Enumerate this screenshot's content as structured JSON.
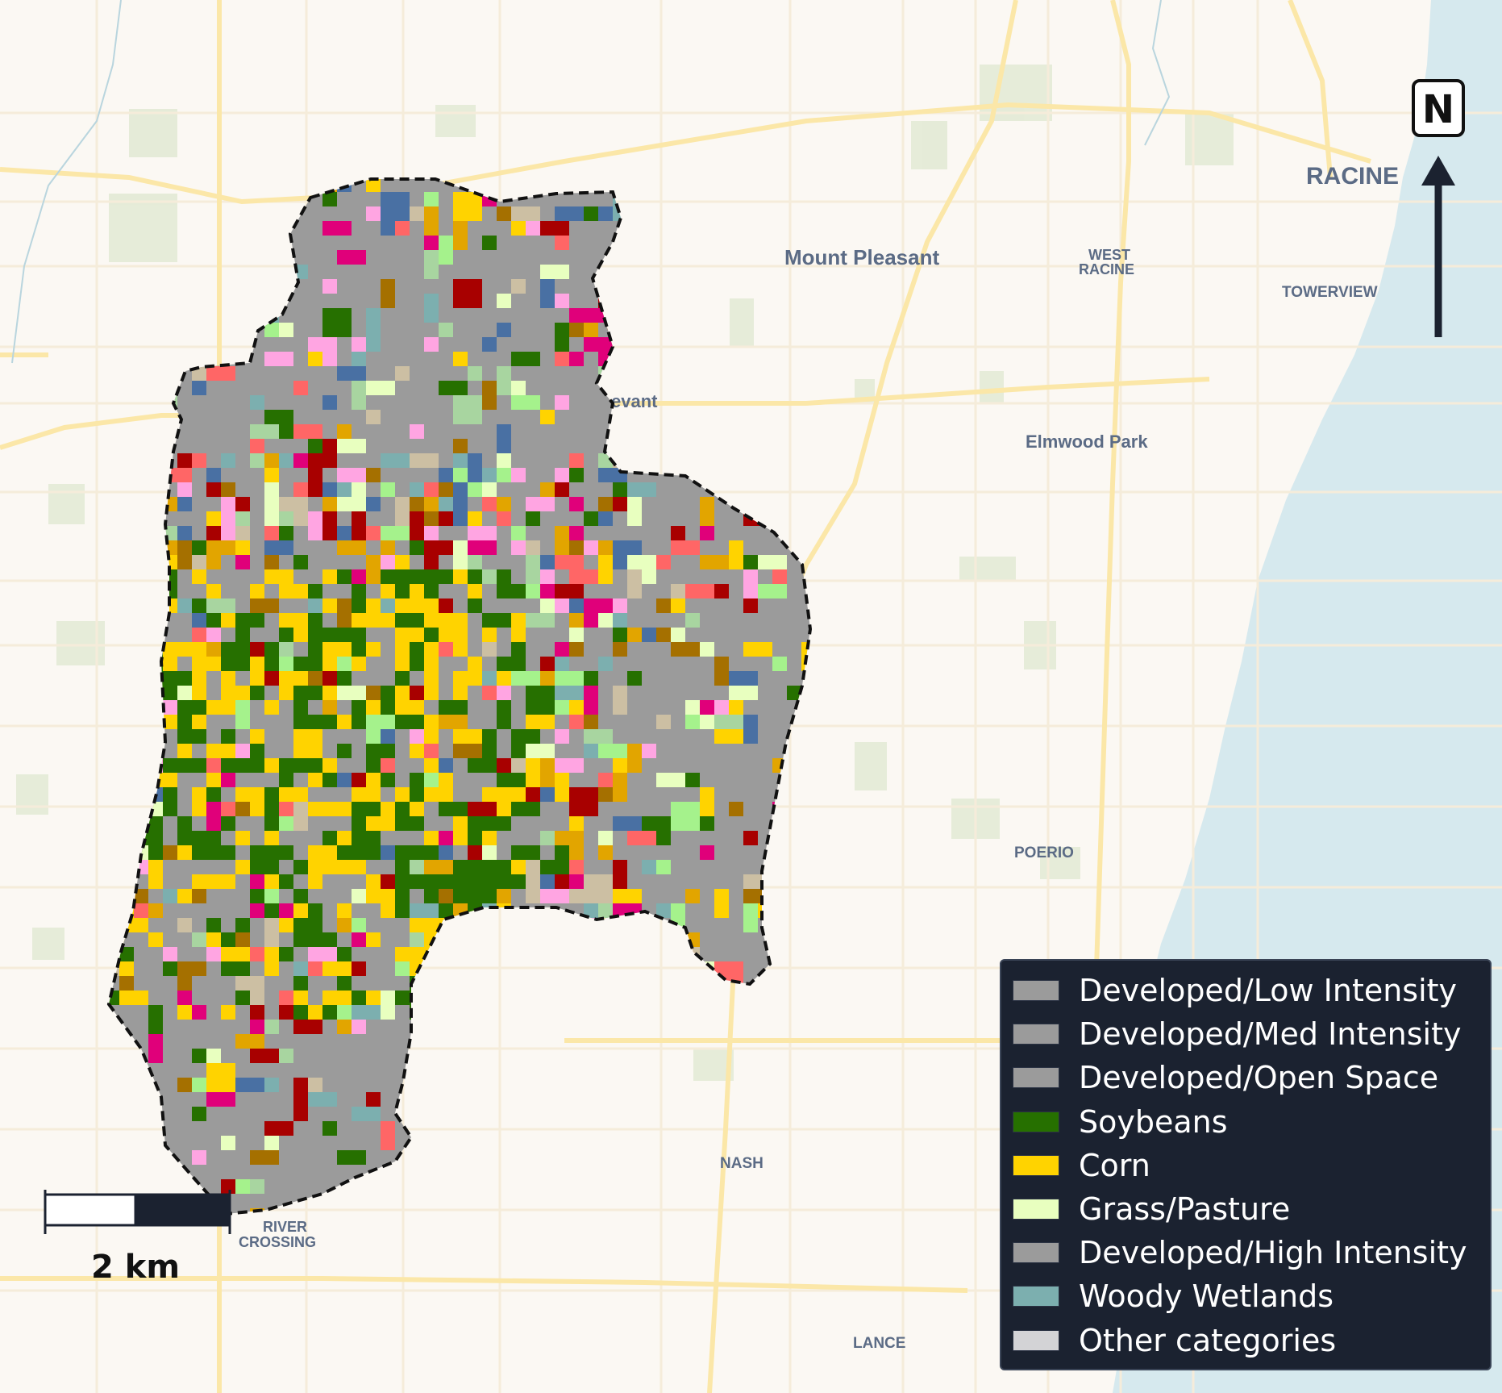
{
  "map": {
    "north_label": "N",
    "scale_label": "2 km",
    "place_labels": {
      "racine": "RACINE",
      "mount_pleasant": "Mount Pleasant",
      "west_racine_1": "WEST",
      "west_racine_2": "RACINE",
      "towerview": "TOWERVIEW",
      "sturtevant": "evant",
      "elmwood_park": "Elmwood Park",
      "poerio": "POERIO",
      "nash": "NASH",
      "lance": "LANCE",
      "river_crossing_1": "RIVER",
      "river_crossing_2": "CROSSING"
    }
  },
  "legend": {
    "items": [
      {
        "label": "Developed/Low Intensity",
        "color": "#9b9b9b"
      },
      {
        "label": "Developed/Med Intensity",
        "color": "#9b9b9b"
      },
      {
        "label": "Developed/Open Space",
        "color": "#9b9b9b"
      },
      {
        "label": "Soybeans",
        "color": "#267000"
      },
      {
        "label": "Corn",
        "color": "#ffd300"
      },
      {
        "label": "Grass/Pasture",
        "color": "#e8ffbf"
      },
      {
        "label": "Developed/High Intensity",
        "color": "#9b9b9b"
      },
      {
        "label": "Woody Wetlands",
        "color": "#7cafaf"
      },
      {
        "label": "Other categories",
        "color": "#d3d3d6"
      }
    ]
  }
}
